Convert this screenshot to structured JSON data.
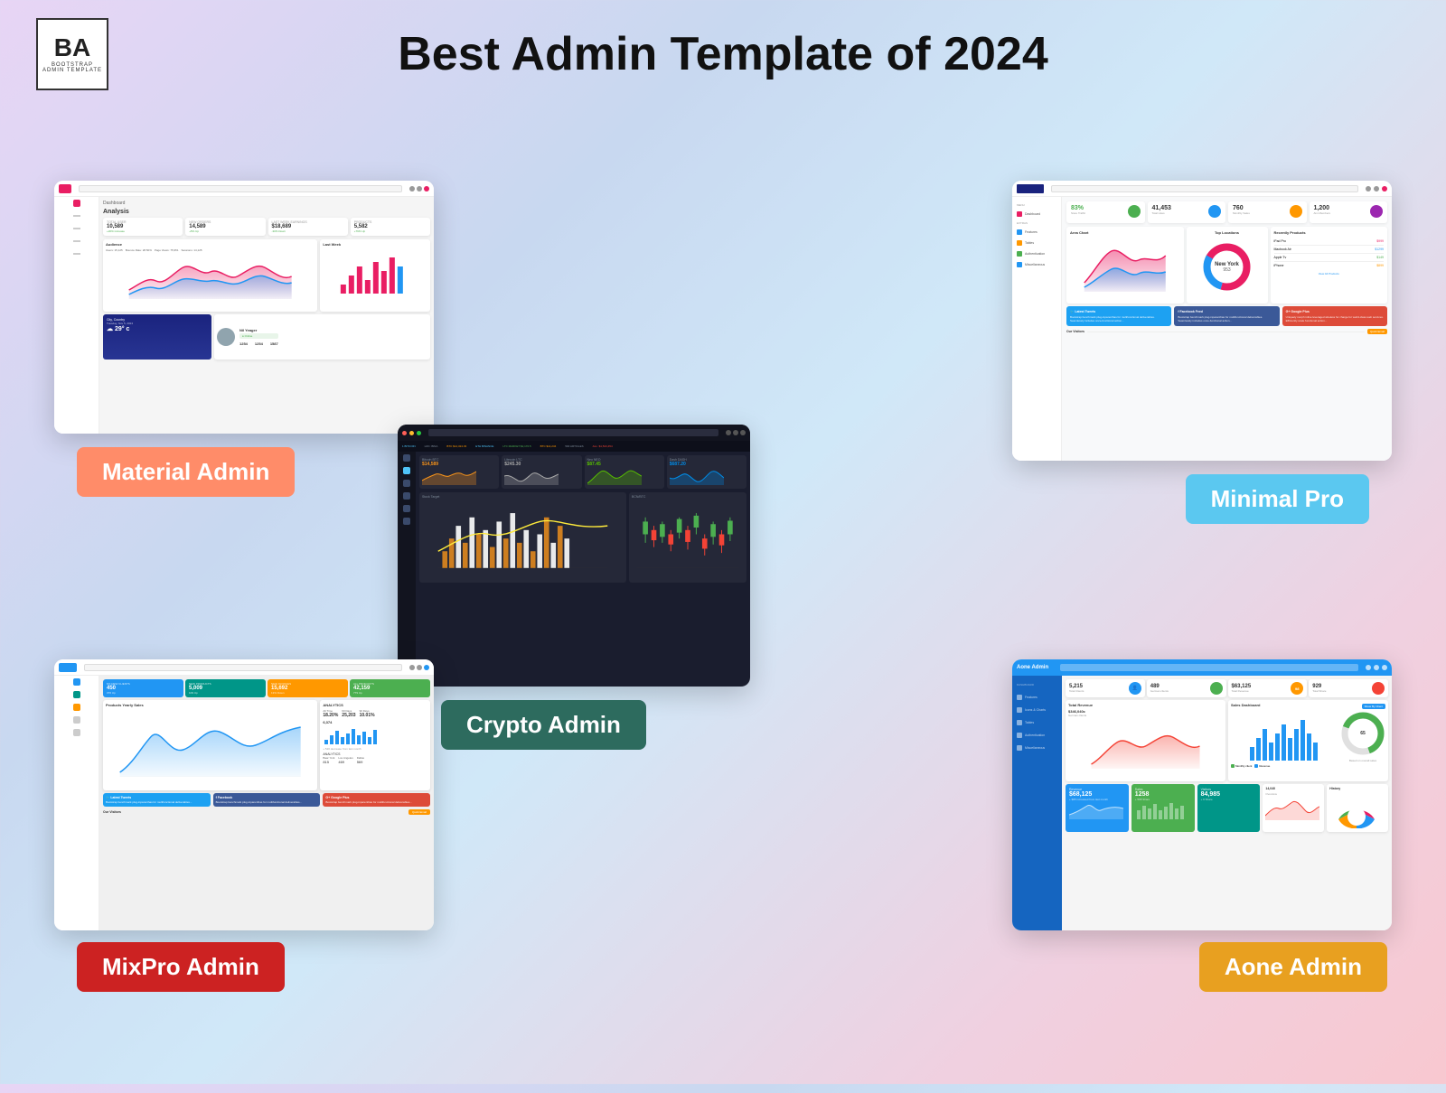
{
  "header": {
    "title": "Best Admin Template of 2024",
    "logo": {
      "letters": "BA",
      "subtext": "BOOTSTRAP\nADMIN TEMPLATE"
    }
  },
  "templates": {
    "material_admin": {
      "name": "Material Admin",
      "label_bg": "#ff8c69",
      "stats": [
        {
          "label": "TOTAL USER",
          "value": "10,589",
          "sub": "+20% increase in 28 Days"
        },
        {
          "label": "NEW ORDERS",
          "value": "14,589",
          "sub": "+5% Up"
        },
        {
          "label": "LAST WEEK EARNINGS",
          "value": "$18,689",
          "sub": "+30% Down"
        },
        {
          "label": "PRODUCTS DELIVERED",
          "value": "5,582",
          "sub": "+79% Up"
        }
      ],
      "sections": [
        "Audience",
        "Last Week"
      ],
      "weather": {
        "city": "City, Country",
        "temp": "29° c"
      },
      "user": {
        "name": "Nil Yeager"
      },
      "nums": [
        "1254",
        "1254",
        "1587"
      ]
    },
    "crypto_admin": {
      "name": "Crypto Admin",
      "label_bg": "#2d6b5e",
      "coins": [
        {
          "name": "Bitcoin BTC",
          "color": "#f7931a"
        },
        {
          "name": "Litecoin LTC",
          "color": "#b5b5b5"
        },
        {
          "name": "Neo NEO",
          "color": "#58bf00"
        },
        {
          "name": "Dash DASH",
          "color": "#008ce7"
        }
      ],
      "charts": [
        "Stock Target",
        "BCN/BTC"
      ]
    },
    "minimal_pro": {
      "name": "Minimal Pro",
      "label_bg": "#5bc8f0",
      "stats": [
        {
          "label": "Store Traffic",
          "value": "83%",
          "color": "#4caf50"
        },
        {
          "label": "Total Likes",
          "value": "41,453",
          "color": "#2196f3"
        },
        {
          "label": "Monthly Sales",
          "value": "760",
          "color": "#ff9800"
        },
        {
          "label": "Aim Members",
          "value": "1,200",
          "color": "#9c27b0"
        }
      ],
      "donut": {
        "label": "New York",
        "value": "953"
      },
      "sections": [
        "Area Chart",
        "Top Locations",
        "Recently Products"
      ],
      "products": [
        "iPad Pro",
        "Macbook Air",
        "Apple Tv",
        "iPhone"
      ],
      "social": [
        "Latest Tweets",
        "Facebook Feed",
        "Google Plus"
      ]
    },
    "mixpro_admin": {
      "name": "MixPro Admin",
      "label_bg": "#cc2222",
      "stats": [
        {
          "label": "MY NEW CLIENTS",
          "value": "450",
          "sub": "376 Up",
          "color": "#2196f3"
        },
        {
          "label": "NEW PRODUCTS",
          "value": "5,009",
          "sub": "109 Up",
          "color": "#009688"
        },
        {
          "label": "NEW INVOICES",
          "value": "15,692",
          "sub": "13% Down",
          "color": "#ff9800"
        },
        {
          "label": "ALL PRODUCTS",
          "value": "42,159",
          "sub": "779 Up",
          "color": "#4caf50"
        }
      ],
      "chart": "Products Yearly Sales",
      "social": [
        "Latest Tweets",
        "Facebook",
        "Google Plus"
      ]
    },
    "aone_admin": {
      "name": "Aone Admin",
      "label_bg": "#e8a020",
      "stats": [
        {
          "label": "Total Clients",
          "value": "5,215",
          "color": "#2196f3"
        },
        {
          "label": "",
          "value": "489",
          "color": "#4caf50"
        },
        {
          "label": "Total Revenue",
          "value": "$63,125",
          "color": "#ff9800"
        },
        {
          "label": "",
          "value": "929",
          "color": "#f44336"
        }
      ],
      "charts": [
        "Total Revenue",
        "Sales Dashboard"
      ],
      "bottom": [
        {
          "label": "Revenue",
          "value": "$68,125",
          "color": "#2196f3"
        },
        {
          "label": "Sales",
          "value": "1258",
          "color": "#4caf50"
        },
        {
          "label": "Visitors",
          "value": "84,985",
          "color": "#009688"
        }
      ],
      "rating": "65",
      "sections": [
        "Overview",
        "History"
      ]
    }
  }
}
